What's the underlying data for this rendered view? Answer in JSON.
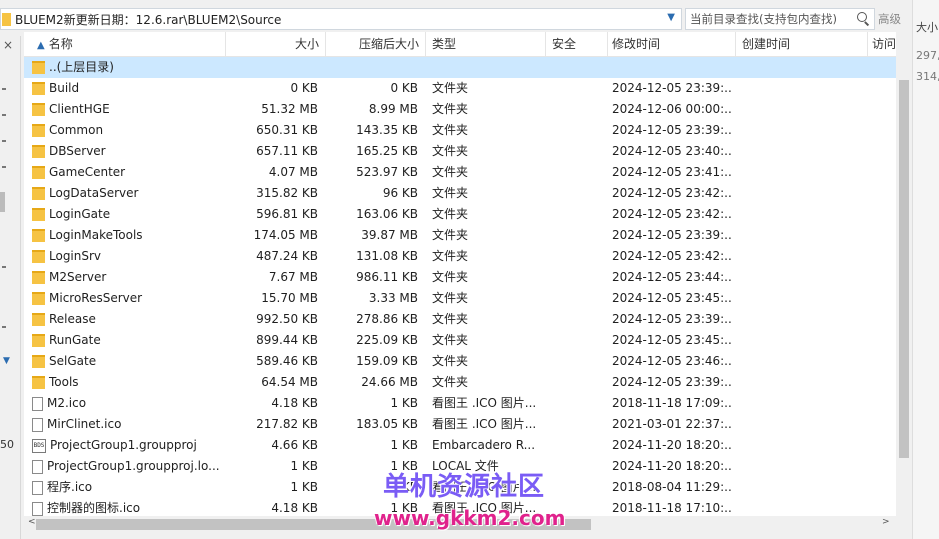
{
  "address": {
    "path": "BLUEM2新更新日期：12.6.rar\\BLUEM2\\Source",
    "dropdown_icon": "chevron-down-icon"
  },
  "search": {
    "placeholder": "当前目录查找(支持包内查找)",
    "advanced_label": "高级"
  },
  "columns": {
    "name": "名称",
    "size": "大小",
    "compressed": "压缩后大小",
    "type": "类型",
    "security": "安全",
    "modified": "修改时间",
    "created": "创建时间",
    "accessed": "访问"
  },
  "rows": [
    {
      "icon": "folder-icon",
      "name": "..(上层目录)",
      "size": "",
      "compressed": "",
      "type": "",
      "modified": ""
    },
    {
      "icon": "folder-icon",
      "name": "Build",
      "size": "0 KB",
      "compressed": "0 KB",
      "type": "文件夹",
      "modified": "2024-12-05 23:39:..."
    },
    {
      "icon": "folder-icon",
      "name": "ClientHGE",
      "size": "51.32 MB",
      "compressed": "8.99 MB",
      "type": "文件夹",
      "modified": "2024-12-06 00:00:..."
    },
    {
      "icon": "folder-icon",
      "name": "Common",
      "size": "650.31 KB",
      "compressed": "143.35 KB",
      "type": "文件夹",
      "modified": "2024-12-05 23:39:..."
    },
    {
      "icon": "folder-icon",
      "name": "DBServer",
      "size": "657.11 KB",
      "compressed": "165.25 KB",
      "type": "文件夹",
      "modified": "2024-12-05 23:40:..."
    },
    {
      "icon": "folder-icon",
      "name": "GameCenter",
      "size": "4.07 MB",
      "compressed": "523.97 KB",
      "type": "文件夹",
      "modified": "2024-12-05 23:41:..."
    },
    {
      "icon": "folder-icon",
      "name": "LogDataServer",
      "size": "315.82 KB",
      "compressed": "96 KB",
      "type": "文件夹",
      "modified": "2024-12-05 23:42:..."
    },
    {
      "icon": "folder-icon",
      "name": "LoginGate",
      "size": "596.81 KB",
      "compressed": "163.06 KB",
      "type": "文件夹",
      "modified": "2024-12-05 23:42:..."
    },
    {
      "icon": "folder-icon",
      "name": "LoginMakeTools",
      "size": "174.05 MB",
      "compressed": "39.87 MB",
      "type": "文件夹",
      "modified": "2024-12-05 23:39:..."
    },
    {
      "icon": "folder-icon",
      "name": "LoginSrv",
      "size": "487.24 KB",
      "compressed": "131.08 KB",
      "type": "文件夹",
      "modified": "2024-12-05 23:42:..."
    },
    {
      "icon": "folder-icon",
      "name": "M2Server",
      "size": "7.67 MB",
      "compressed": "986.11 KB",
      "type": "文件夹",
      "modified": "2024-12-05 23:44:..."
    },
    {
      "icon": "folder-icon",
      "name": "MicroResServer",
      "size": "15.70 MB",
      "compressed": "3.33 MB",
      "type": "文件夹",
      "modified": "2024-12-05 23:45:..."
    },
    {
      "icon": "folder-icon",
      "name": "Release",
      "size": "992.50 KB",
      "compressed": "278.86 KB",
      "type": "文件夹",
      "modified": "2024-12-05 23:39:..."
    },
    {
      "icon": "folder-icon",
      "name": "RunGate",
      "size": "899.44 KB",
      "compressed": "225.09 KB",
      "type": "文件夹",
      "modified": "2024-12-05 23:45:..."
    },
    {
      "icon": "folder-icon",
      "name": "SelGate",
      "size": "589.46 KB",
      "compressed": "159.09 KB",
      "type": "文件夹",
      "modified": "2024-12-05 23:46:..."
    },
    {
      "icon": "folder-icon",
      "name": "Tools",
      "size": "64.54 MB",
      "compressed": "24.66 MB",
      "type": "文件夹",
      "modified": "2024-12-05 23:39:..."
    },
    {
      "icon": "file-icon",
      "name": "M2.ico",
      "size": "4.18 KB",
      "compressed": "1 KB",
      "type": "看图王 .ICO 图片...",
      "modified": "2018-11-18 17:09:..."
    },
    {
      "icon": "file-icon",
      "name": "MirClinet.ico",
      "size": "217.82 KB",
      "compressed": "183.05 KB",
      "type": "看图王 .ICO 图片...",
      "modified": "2021-03-01 22:37:..."
    },
    {
      "icon": "bds-icon",
      "name": "ProjectGroup1.groupproj",
      "size": "4.66 KB",
      "compressed": "1 KB",
      "type": "Embarcadero R...",
      "modified": "2024-11-20 18:20:..."
    },
    {
      "icon": "file-icon",
      "name": "ProjectGroup1.groupproj.lo...",
      "size": "1 KB",
      "compressed": "1 KB",
      "type": "LOCAL 文件",
      "modified": "2024-11-20 18:20:..."
    },
    {
      "icon": "file-icon",
      "name": "程序.ico",
      "size": "1 KB",
      "compressed": "1 KB",
      "type": "看图王 .ICO 图片...",
      "modified": "2018-08-04 11:29:..."
    },
    {
      "icon": "file-icon",
      "name": "控制器的图标.ico",
      "size": "4.18 KB",
      "compressed": "1 KB",
      "type": "看图王 .ICO 图片...",
      "modified": "2018-11-18 17:10:..."
    }
  ],
  "right_pane": {
    "header": "大小",
    "values": [
      "297,",
      "314,"
    ]
  },
  "left_pane": {
    "close_glyph": "×",
    "number": "50"
  },
  "watermark": {
    "line1": "单机资源社区",
    "line2": "www.gkkm2.com"
  },
  "colors": {
    "selection": "#cce8ff",
    "folder": "#f6c343",
    "accent": "#2b6cb0"
  }
}
